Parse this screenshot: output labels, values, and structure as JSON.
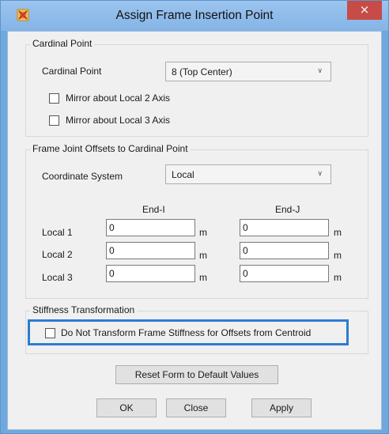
{
  "window": {
    "title": "Assign Frame Insertion Point",
    "close_glyph": "×"
  },
  "cardinal_group": {
    "legend": "Cardinal Point",
    "cardinal_label": "Cardinal Point",
    "cardinal_value": "8  (Top Center)",
    "mirror2_label": "Mirror about Local 2 Axis",
    "mirror3_label": "Mirror about Local 3 Axis"
  },
  "offsets_group": {
    "legend": "Frame Joint Offsets to Cardinal Point",
    "coord_label": "Coordinate System",
    "coord_value": "Local",
    "end_i_header": "End-I",
    "end_j_header": "End-J",
    "rows": [
      {
        "label": "Local 1",
        "end_i": "0",
        "end_j": "0",
        "unit": "m"
      },
      {
        "label": "Local 2",
        "end_i": "0",
        "end_j": "0",
        "unit": "m"
      },
      {
        "label": "Local 3",
        "end_i": "0",
        "end_j": "0",
        "unit": "m"
      }
    ]
  },
  "stiffness_group": {
    "legend": "Stiffness Transformation",
    "checkbox_label": "Do Not Transform Frame Stiffness for Offsets from Centroid"
  },
  "buttons": {
    "reset": "Reset Form to Default Values",
    "ok": "OK",
    "close": "Close",
    "apply": "Apply"
  },
  "icons": {
    "app": "sap-app-icon",
    "dropdown": "chevron-down-icon",
    "close": "close-icon"
  },
  "colors": {
    "title_bar": "#9cc4ee",
    "close_button": "#c74b47",
    "highlight": "#2e7bd1",
    "dialog_bg": "#f0f0f0"
  }
}
